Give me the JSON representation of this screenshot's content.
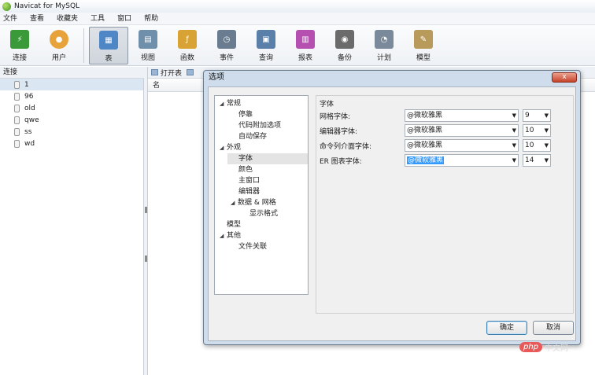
{
  "window": {
    "title": "Navicat for MySQL"
  },
  "menu": [
    "文件",
    "查看",
    "收藏夹",
    "工具",
    "窗口",
    "帮助"
  ],
  "toolbar": {
    "buttons": [
      {
        "label": "连接",
        "icon": "connection-icon",
        "color": "#3a9a3a"
      },
      {
        "label": "用户",
        "icon": "user-icon",
        "color": "#e8a23a"
      },
      {
        "label": "表",
        "icon": "table-icon",
        "color": "#4f86c6"
      },
      {
        "label": "视图",
        "icon": "view-icon",
        "color": "#6f8faa"
      },
      {
        "label": "函数",
        "icon": "function-icon",
        "color": "#d8a235"
      },
      {
        "label": "事件",
        "icon": "event-icon",
        "color": "#6a7c8f"
      },
      {
        "label": "查询",
        "icon": "query-icon",
        "color": "#5a7fa8"
      },
      {
        "label": "报表",
        "icon": "report-icon",
        "color": "#b54fb0"
      },
      {
        "label": "备份",
        "icon": "backup-icon",
        "color": "#6b6b6b"
      },
      {
        "label": "计划",
        "icon": "schedule-icon",
        "color": "#7a8a9a"
      },
      {
        "label": "模型",
        "icon": "model-icon",
        "color": "#b89a5a"
      }
    ]
  },
  "connections": {
    "header": "连接",
    "items": [
      "1",
      "96",
      "old",
      "qwe",
      "ss",
      "wd"
    ]
  },
  "object_toolbar": {
    "open_table": "打开表"
  },
  "object_list": {
    "column_name": "名"
  },
  "dialog": {
    "title": "选项",
    "close": "x",
    "tree": {
      "general": "常规",
      "docking": "停靠",
      "code_append": "代码附加选项",
      "autosave": "自动保存",
      "appearance": "外观",
      "font": "字体",
      "color": "颜色",
      "main_window": "主窗口",
      "editor": "编辑器",
      "data_grid": "数据 & 网格",
      "display_format": "显示格式",
      "model": "模型",
      "other": "其他",
      "file_assoc": "文件关联"
    },
    "font_panel": {
      "title": "字体",
      "rows": [
        {
          "label": "网格字体:",
          "font": "@微软雅黑",
          "size": "9"
        },
        {
          "label": "编辑器字体:",
          "font": "@微软雅黑",
          "size": "10"
        },
        {
          "label": "命令列介面字体:",
          "font": "@微软雅黑",
          "size": "10"
        },
        {
          "label": "ER 图表字体:",
          "font": "@微软雅黑",
          "size": "14"
        }
      ]
    },
    "ok": "确定",
    "cancel": "取消"
  },
  "watermark": {
    "brand": "php",
    "site": "中文网"
  }
}
